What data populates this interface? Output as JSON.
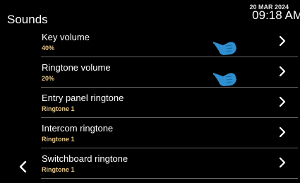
{
  "header": {
    "title": "Sounds",
    "date": "20 MAR 2024",
    "time": "09:18 AM"
  },
  "items": [
    {
      "label": "Key volume",
      "value": "40%"
    },
    {
      "label": "Ringtone volume",
      "value": "20%"
    },
    {
      "label": "Entry panel ringtone",
      "value": "Ringtone 1"
    },
    {
      "label": "Intercom ringtone",
      "value": "Ringtone 1"
    },
    {
      "label": "Switchboard ringtone",
      "value": "Ringtone 1"
    }
  ],
  "icons": {
    "back": "chevron-left-icon",
    "row": "chevron-right-icon",
    "pointer": "hand-pointer-icon"
  },
  "colors": {
    "background": "#000000",
    "value_text": "#e8c98a",
    "pointer": "#2f8fd0",
    "divider": "#666666"
  }
}
